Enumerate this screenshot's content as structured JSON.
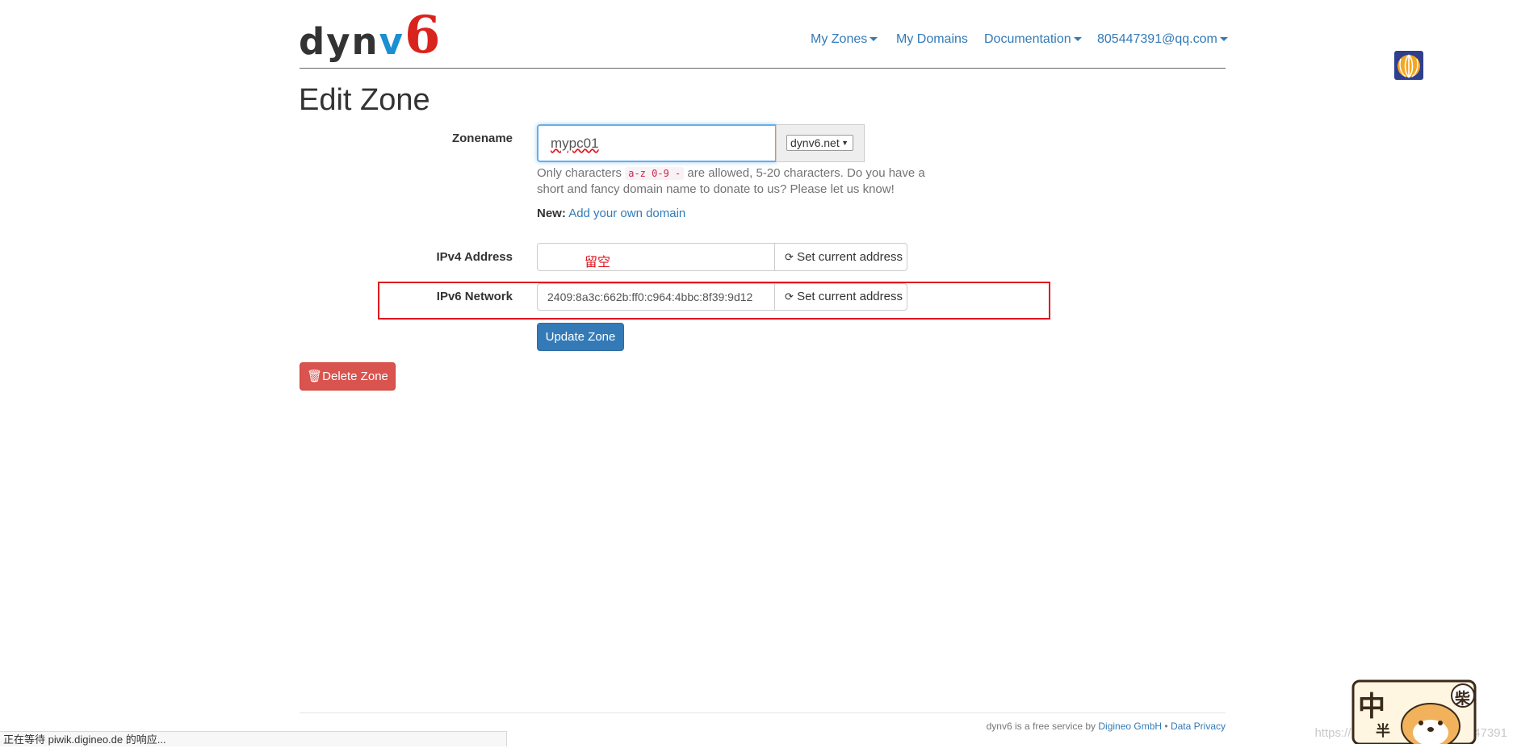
{
  "header": {
    "logo": {
      "part1": "dyn",
      "part2": "v",
      "part3": "6"
    },
    "nav": [
      {
        "label": "My Zones",
        "dropdown": true
      },
      {
        "label": "My Domains",
        "dropdown": false
      },
      {
        "label": "Documentation",
        "dropdown": true
      },
      {
        "label": "805447391@qq.com",
        "dropdown": true
      }
    ]
  },
  "page_title": "Edit Zone",
  "form": {
    "zonename_label": "Zonename",
    "zonename_value": "mypc01",
    "domain_select": "dynv6.net",
    "help_text_1": "Only characters",
    "help_code": "a-z 0-9 -",
    "help_text_2": "are allowed, 5-20 characters. Do you have a",
    "help_text_3": "short and fancy domain name to donate to us? Please let us know!",
    "new_label": "New:",
    "new_link": "Add your own domain",
    "ipv4_label": "IPv4 Address",
    "ipv4_value": "",
    "ipv4_annotation": "留空",
    "ipv6_label": "IPv6 Network",
    "ipv6_value": "2409:8a3c:662b:ff0:c964:4bbc:8f39:9d12",
    "set_current_label": "Set current address",
    "update_button": "Update Zone",
    "delete_button": "Delete Zone"
  },
  "footer": {
    "text": "dynv6 is a free service by",
    "company_link": "Digineo GmbH",
    "separator": "•",
    "privacy_link": "Data Privacy"
  },
  "statusbar": "正在等待 piwik.digineo.de 的响应...",
  "watermark": "https://blog.csdn.net/qq_805447391",
  "sticker": {
    "char1": "中",
    "char2": "柴",
    "char3": "半"
  },
  "colors": {
    "brand_blue": "#1a8fd2",
    "brand_red": "#d9231d",
    "link": "#337ab7",
    "primary": "#337ab7",
    "danger": "#d9534f",
    "highlight_box": "#e0141e"
  }
}
